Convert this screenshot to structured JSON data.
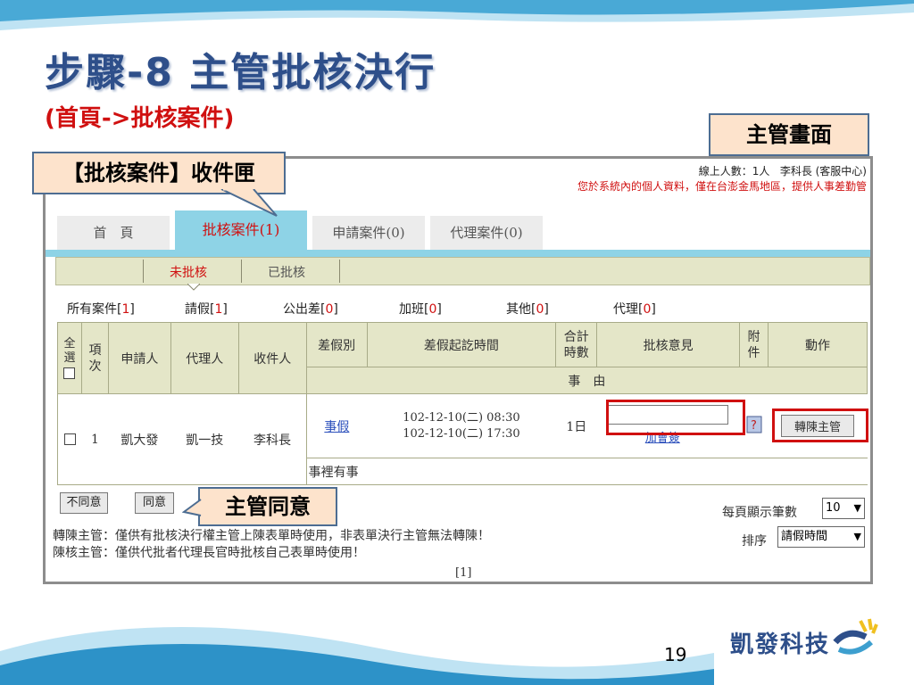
{
  "slide": {
    "title": "步驟-8  主管批核決行",
    "subtitle": "(首頁->批核案件)",
    "page_number": "19",
    "logo_text": "凱發科技"
  },
  "callouts": {
    "top_right": "主管畫面",
    "inbox": "【批核案件】收件匣",
    "approve": "主管同意"
  },
  "app": {
    "online_count": "線上人數：1人",
    "user": "李科長 (客服中心)",
    "notice": "您於系統內的個人資料，僅在台澎金馬地區，提供人事差勤管",
    "tabs": [
      "首　頁",
      "批核案件(1)",
      "申請案件(0)",
      "代理案件(0)"
    ],
    "active_tab": 1,
    "subtabs": [
      "未批核",
      "已批核"
    ],
    "filters": [
      {
        "label": "所有案件",
        "count": "1"
      },
      {
        "label": "請假",
        "count": "1"
      },
      {
        "label": "公出差",
        "count": "0"
      },
      {
        "label": "加班",
        "count": "0"
      },
      {
        "label": "其他",
        "count": "0"
      },
      {
        "label": "代理",
        "count": "0"
      }
    ],
    "table": {
      "headers": {
        "select_all": "全選",
        "index": "項次",
        "applicant": "申請人",
        "agent": "代理人",
        "receiver": "收件人",
        "leave_type": "差假別",
        "period": "差假起訖時間",
        "total_hours": "合計時數",
        "opinion": "批核意見",
        "attachment": "附件",
        "action": "動作",
        "reason": "事　由"
      },
      "row": {
        "index": "1",
        "applicant": "凱大發",
        "agent": "凱一技",
        "receiver": "李科長",
        "leave_type": "事假",
        "start": "102-12-10(二) 08:30",
        "end": "102-12-10(二) 17:30",
        "total": "1日",
        "opinion_value": "",
        "add_sign": "加會簽",
        "action_button": "轉陳主管",
        "reason": "事裡有事"
      }
    },
    "buttons": {
      "disagree": "不同意",
      "agree": "同意"
    },
    "per_page_label": "每頁顯示筆數",
    "per_page_value": "10",
    "sort_label": "排序",
    "sort_value": "請假時間",
    "notes": [
      "轉陳主管：僅供有批核決行權主管上陳表單時使用，非表單決行主管無法轉陳！",
      "陳核主管：僅供代批者代理長官時批核自己表單時使用！"
    ],
    "pager": "[1]"
  },
  "colors": {
    "title": "#2e4f8a",
    "accent_red": "#d01010",
    "tab_active": "#8ed3e6",
    "table_header": "#e4e6c8",
    "callout_bg": "#fde3cc",
    "wave": "#3d9fcf"
  }
}
